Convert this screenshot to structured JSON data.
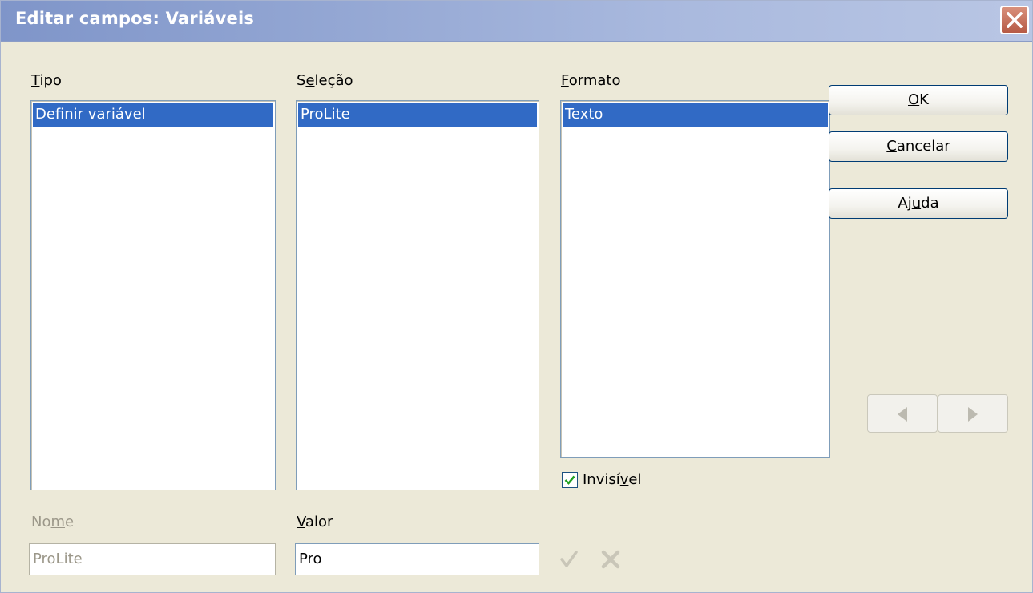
{
  "window": {
    "title": "Editar campos: Variáveis",
    "close_icon": "close-icon"
  },
  "tipo": {
    "label_mnemonic": "T",
    "label_rest": "ipo",
    "items": [
      "Definir variável"
    ],
    "selected": "Definir variável"
  },
  "selecao": {
    "label_pre": "S",
    "label_mnemonic": "e",
    "label_rest": "leção",
    "items": [
      "ProLite"
    ],
    "selected": "ProLite"
  },
  "formato": {
    "label_mnemonic": "F",
    "label_rest": "ormato",
    "items": [
      "Texto"
    ],
    "selected": "Texto"
  },
  "invisivel": {
    "label_pre": "Invisí",
    "label_mnemonic": "v",
    "label_rest": "el",
    "checked": true
  },
  "nome": {
    "label_pre": "No",
    "label_mnemonic": "m",
    "label_rest": "e",
    "value": "ProLite",
    "enabled": false
  },
  "valor": {
    "label_mnemonic": "V",
    "label_rest": "alor",
    "value": "Pro"
  },
  "buttons": {
    "ok_mnemonic": "O",
    "ok_rest": "K",
    "cancel_mnemonic": "C",
    "cancel_rest": "ancelar",
    "help_pre": "Aj",
    "help_mnemonic": "u",
    "help_rest": "da"
  },
  "nav": {
    "prev_icon": "triangle-left-icon",
    "next_icon": "triangle-right-icon",
    "enabled": false
  },
  "edit_tools": {
    "apply_icon": "checkmark-icon",
    "delete_icon": "x-delete-icon",
    "enabled": false
  },
  "colors": {
    "selection": "#316ac5",
    "titlebar_start": "#7f95c9",
    "dialog_bg": "#ece9d8",
    "checkbox_check": "#21a121"
  }
}
